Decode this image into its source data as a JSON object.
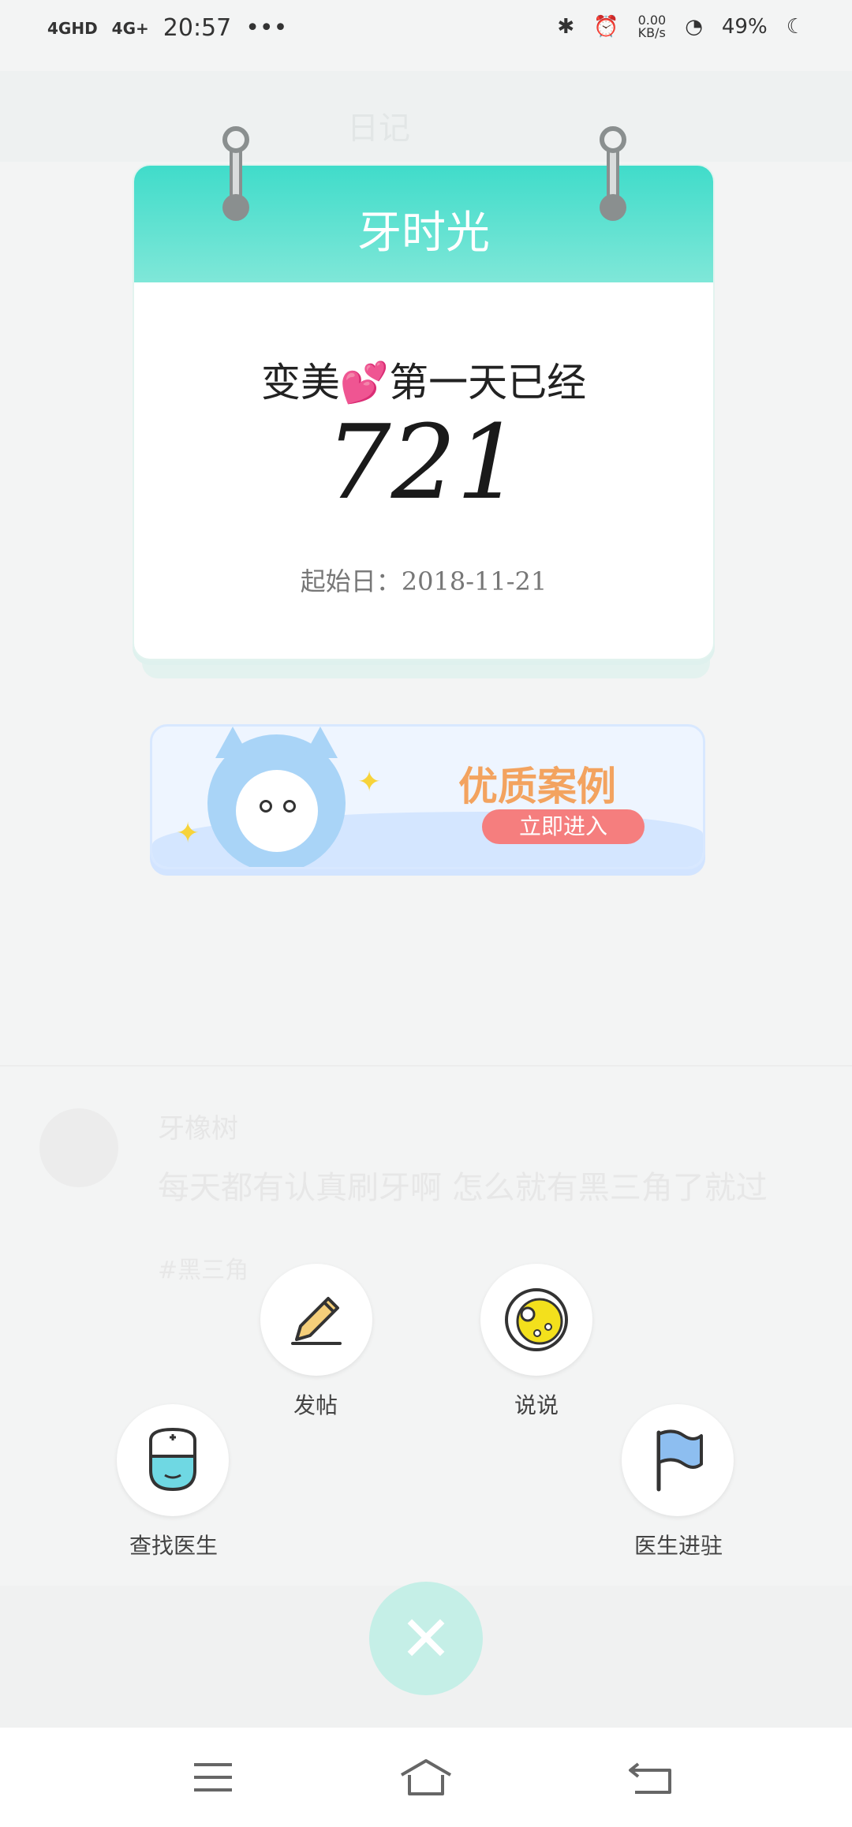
{
  "status_bar": {
    "network1": "4GHD",
    "network2": "4G+",
    "time": "20:57",
    "dots": "•••",
    "speed": "0.00",
    "speed_unit": "KB/s",
    "battery": "49%"
  },
  "background": {
    "title": "日记",
    "post_author": "牙橡树",
    "post_text": "每天都有认真刷牙啊 怎么就有黑三角了就过",
    "post_tag": "#黑三角"
  },
  "calendar": {
    "title": "牙时光",
    "line1_before": "变美",
    "line1_after": "第一天已经",
    "heart": "💕",
    "count": "721",
    "start_label": "起始日：",
    "start_date": "2018-11-21"
  },
  "banner": {
    "title": "优质案例",
    "button": "立即进入"
  },
  "menu": {
    "post": "发帖",
    "say": "说说",
    "find_doctor": "查找医生",
    "doctor_join": "医生进驻"
  },
  "colors": {
    "accent": "#40dcca",
    "close_fab": "#c5efe7",
    "banner_title": "#f3a35f",
    "banner_button": "#f57e7e"
  }
}
